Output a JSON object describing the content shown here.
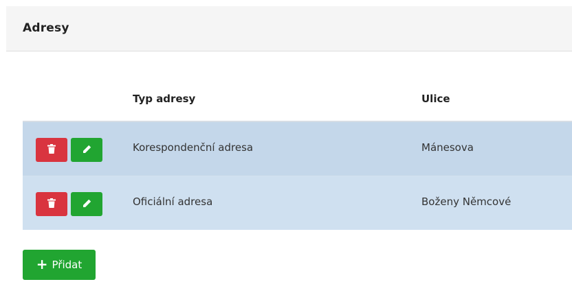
{
  "panel": {
    "title": "Adresy"
  },
  "table": {
    "columns": [
      "Typ adresy",
      "Ulice"
    ],
    "rows": [
      {
        "type": "Korespondenční adresa",
        "street": "Mánesova"
      },
      {
        "type": "Oficiální adresa",
        "street": "Boženy Němcové"
      }
    ]
  },
  "actions": {
    "delete_icon": "trash-icon",
    "edit_icon": "pencil-icon",
    "add_label": "Přidat",
    "add_icon": "plus-icon"
  },
  "colors": {
    "danger": "#d9343f",
    "success": "#21a531",
    "row_primary": "#c4d7ea",
    "row_secondary": "#cfe0f0"
  }
}
